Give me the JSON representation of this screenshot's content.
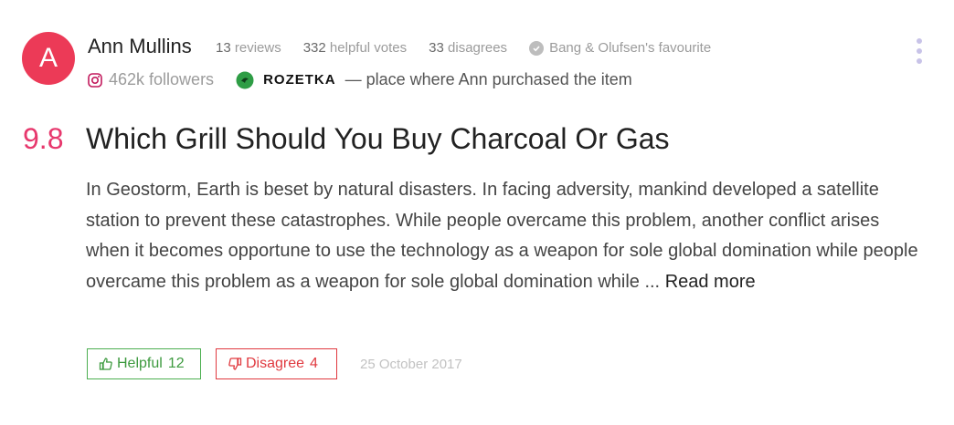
{
  "author": {
    "initial": "A",
    "name": "Ann Mullins",
    "avatar_color": "#ec3a57"
  },
  "stats": {
    "reviews_count": "13",
    "reviews_label": "reviews",
    "helpful_votes_count": "332",
    "helpful_votes_label": "helpful votes",
    "disagrees_count": "33",
    "disagrees_label": "disagrees",
    "favourite": "Bang & Olufsen's favourite"
  },
  "social": {
    "followers": "462k followers",
    "icon": "instagram-icon"
  },
  "store": {
    "name": "ROZETKA",
    "note": "— place where Ann purchased the item",
    "icon": "rozetka-logo"
  },
  "review": {
    "score": "9.8",
    "score_color": "#e7386d",
    "title": "Which Grill Should You Buy Charcoal Or Gas",
    "body": "In Geostorm, Earth is beset by natural disasters. In facing adversity, mankind developed a satellite station to prevent these catastrophes. While people overcame this problem, another conflict arises when it becomes opportune to use the technology as a weapon for sole global domination while people overcame this problem as a weapon for sole global domination while ...",
    "read_more": "Read more"
  },
  "actions": {
    "helpful_label": "Helpful",
    "helpful_count": "12",
    "helpful_color": "#4caf50",
    "disagree_label": "Disagree",
    "disagree_count": "4",
    "disagree_color": "#e0393f"
  },
  "date": "25 October 2017",
  "menu_icon": "kebab-menu-icon"
}
